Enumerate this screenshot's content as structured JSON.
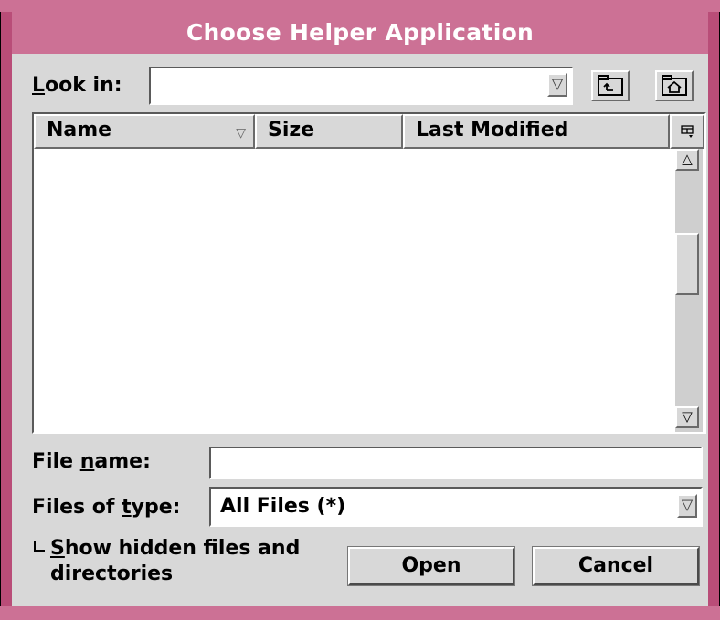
{
  "dialog": {
    "title": "Choose Helper Application"
  },
  "look_in": {
    "label_prefix": "",
    "label_accel": "L",
    "label_rest": "ook in:",
    "value": "",
    "dropdown_icon": "down-triangle",
    "up_folder_icon": "folder-up-icon",
    "home_folder_icon": "home-folder-icon"
  },
  "file_list": {
    "columns": [
      {
        "label": "Name",
        "sort_icon": "▽"
      },
      {
        "label": "Size"
      },
      {
        "label": "Last Modified"
      }
    ],
    "column_menu_icon": "column-menu-icon",
    "rows": []
  },
  "file_name": {
    "label_prefix": "File ",
    "label_accel": "n",
    "label_rest": "ame:",
    "value": ""
  },
  "files_of_type": {
    "label_prefix": "Files of ",
    "label_accel": "t",
    "label_rest": "ype:",
    "selected": "All Files (*)"
  },
  "show_hidden": {
    "checked": false,
    "label_accel": "S",
    "label_line1_rest": "how hidden files and",
    "label_line2": "directories"
  },
  "buttons": {
    "open": "Open",
    "cancel": "Cancel"
  },
  "colors": {
    "title_bar": "#cc7195",
    "window_border": "#b94d78",
    "face": "#d8d8d8"
  }
}
